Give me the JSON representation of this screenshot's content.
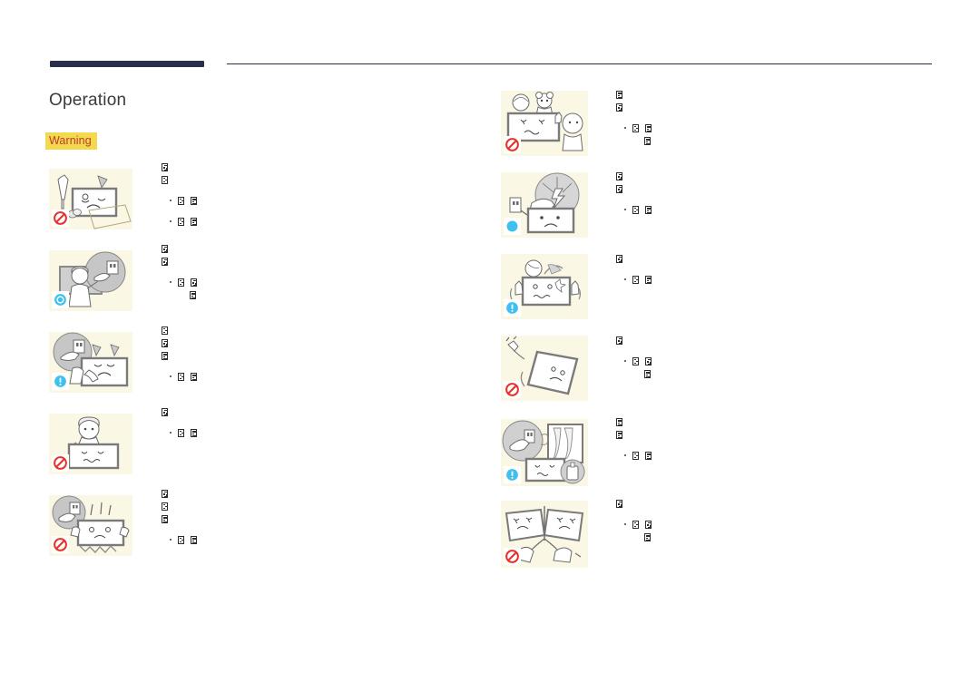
{
  "document": {
    "page_title": "Operation",
    "warning_label": "Warning",
    "header_rule_color": "#2b2e4a",
    "warning_bg_color": "#f2d94e",
    "warning_text_color": "#c0392b",
    "figure_bg_color": "#faf7e4",
    "body_text_note": "All body paragraph text renders as missing-glyph (tofu) boxes"
  },
  "left_column": {
    "items": [
      {
        "figure": {
          "name": "screwdriver-coin-falling-on-display",
          "badge": "prohibited-icon",
          "elements": [
            "screwdriver",
            "coins",
            "sad-display",
            "falling-panel",
            "spark"
          ]
        },
        "text_lines": [
          {
            "indent": "none",
            "glyphs": 1
          },
          {
            "indent": "none",
            "glyphs": 1
          },
          {
            "indent": "bullet",
            "glyphs": 2
          },
          {
            "indent": "bullet",
            "glyphs": 2
          }
        ]
      },
      {
        "figure": {
          "name": "person-unplugging-power-at-wall-outlet",
          "badge": "info-circle-icon",
          "elements": [
            "person",
            "display",
            "magnifier-circle",
            "wall-outlet",
            "hand-on-plug"
          ]
        },
        "text_lines": [
          {
            "indent": "none",
            "glyphs": 1
          },
          {
            "indent": "none",
            "glyphs": 1
          },
          {
            "indent": "bullet",
            "glyphs": 2
          },
          {
            "indent": "sub",
            "glyphs": 1
          }
        ]
      },
      {
        "figure": {
          "name": "unplug-display-when-smoke-or-noise",
          "badge": "exclamation-circle-icon",
          "elements": [
            "magnifier-circle",
            "wall-outlet",
            "hand-on-plug",
            "smoke",
            "worried-display"
          ]
        },
        "text_lines": [
          {
            "indent": "none",
            "glyphs": 1
          },
          {
            "indent": "none",
            "glyphs": 1
          },
          {
            "indent": "none",
            "glyphs": 1
          },
          {
            "indent": "bullet",
            "glyphs": 2
          }
        ]
      },
      {
        "figure": {
          "name": "child-hanging-on-display",
          "badge": "prohibited-icon",
          "elements": [
            "child",
            "display",
            "worried-face"
          ]
        },
        "text_lines": [
          {
            "indent": "none",
            "glyphs": 1
          },
          {
            "indent": "bullet",
            "glyphs": 2
          }
        ]
      },
      {
        "figure": {
          "name": "display-falling-shock-unplug",
          "badge": "prohibited-icon",
          "elements": [
            "magnifier-circle",
            "wall-outlet",
            "hand-on-plug",
            "falling-lines",
            "shocked-display",
            "impact-burst"
          ]
        },
        "text_lines": [
          {
            "indent": "none",
            "glyphs": 1
          },
          {
            "indent": "none",
            "glyphs": 1
          },
          {
            "indent": "none",
            "glyphs": 1
          },
          {
            "indent": "bullet",
            "glyphs": 2
          }
        ]
      }
    ]
  },
  "right_column": {
    "items": [
      {
        "figure": {
          "name": "child-reaching-toys-on-display",
          "badge": "prohibited-icon",
          "elements": [
            "ball",
            "teddy-bear",
            "display",
            "child-reaching"
          ]
        },
        "text_lines": [
          {
            "indent": "none",
            "glyphs": 1
          },
          {
            "indent": "none",
            "glyphs": 1
          },
          {
            "indent": "bullet",
            "glyphs": 2
          },
          {
            "indent": "sub",
            "glyphs": 1
          }
        ]
      },
      {
        "figure": {
          "name": "unplug-display-during-lightning-storm",
          "badge": "dot-circle-icon",
          "elements": [
            "wall-outlet",
            "hand-unplugging",
            "lightning-bolt",
            "sad-display"
          ]
        },
        "text_lines": [
          {
            "indent": "none",
            "glyphs": 1
          },
          {
            "indent": "none",
            "glyphs": 1
          },
          {
            "indent": "bullet",
            "glyphs": 2
          }
        ]
      },
      {
        "figure": {
          "name": "do-not-drop-objects-on-display",
          "badge": "exclamation-circle-icon",
          "elements": [
            "ball",
            "impact-spark",
            "shaking-display",
            "raised-hands"
          ]
        },
        "text_lines": [
          {
            "indent": "none",
            "glyphs": 1
          },
          {
            "indent": "bullet",
            "glyphs": 2
          }
        ]
      },
      {
        "figure": {
          "name": "do-not-move-display-by-pulling-cord",
          "badge": "prohibited-icon",
          "elements": [
            "power-cord-plug",
            "tilted-display",
            "motion-arc"
          ]
        },
        "text_lines": [
          {
            "indent": "none",
            "glyphs": 1
          },
          {
            "indent": "bullet",
            "glyphs": 2
          },
          {
            "indent": "sub",
            "glyphs": 1
          }
        ]
      },
      {
        "figure": {
          "name": "gas-leak-do-not-touch-plug-ventilate",
          "badge": "exclamation-circle-icon",
          "elements": [
            "magnifier-circle",
            "hand-on-plug",
            "window-curtain",
            "display",
            "gas-canister"
          ]
        },
        "text_lines": [
          {
            "indent": "none",
            "glyphs": 1
          },
          {
            "indent": "none",
            "glyphs": 1
          },
          {
            "indent": "bullet",
            "glyphs": 2
          }
        ]
      },
      {
        "figure": {
          "name": "do-not-lift-or-move-display-by-cords",
          "badge": "prohibited-icon",
          "elements": [
            "two-displays",
            "crossed-cords",
            "hands-pulling"
          ]
        },
        "text_lines": [
          {
            "indent": "none",
            "glyphs": 1
          },
          {
            "indent": "bullet",
            "glyphs": 2
          },
          {
            "indent": "sub",
            "glyphs": 1
          }
        ]
      }
    ]
  }
}
